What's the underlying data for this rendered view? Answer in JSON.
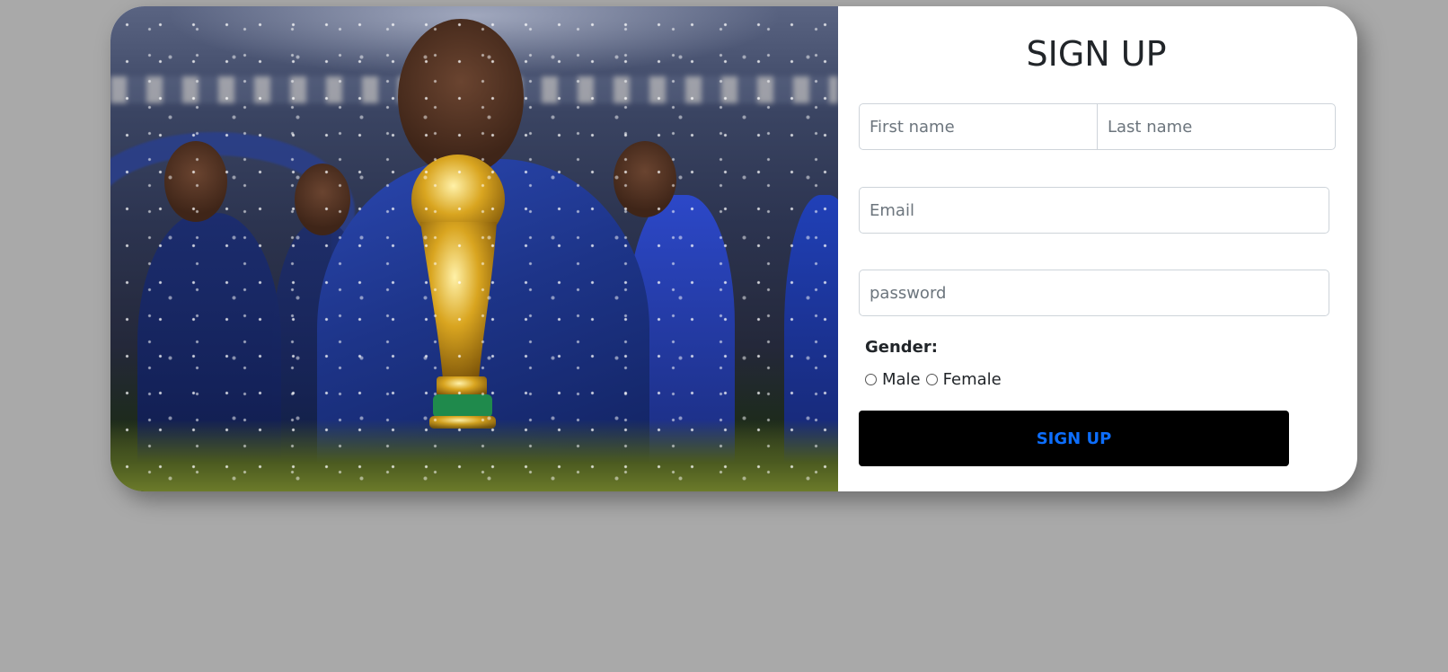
{
  "hero": {
    "image_name": "world-cup-trophy-celebration-photo"
  },
  "form": {
    "title": "SIGN UP",
    "first_name_placeholder": "First name",
    "last_name_placeholder": "Last name",
    "email_placeholder": "Email",
    "password_placeholder": "password",
    "gender_label": "Gender:",
    "gender_options": [
      "Male",
      "Female"
    ],
    "submit_label": "SIGN UP"
  },
  "colors": {
    "page_background": "#a9a9a9",
    "card_background": "#ffffff",
    "button_background": "#000000",
    "button_text": "#0d6efd"
  }
}
